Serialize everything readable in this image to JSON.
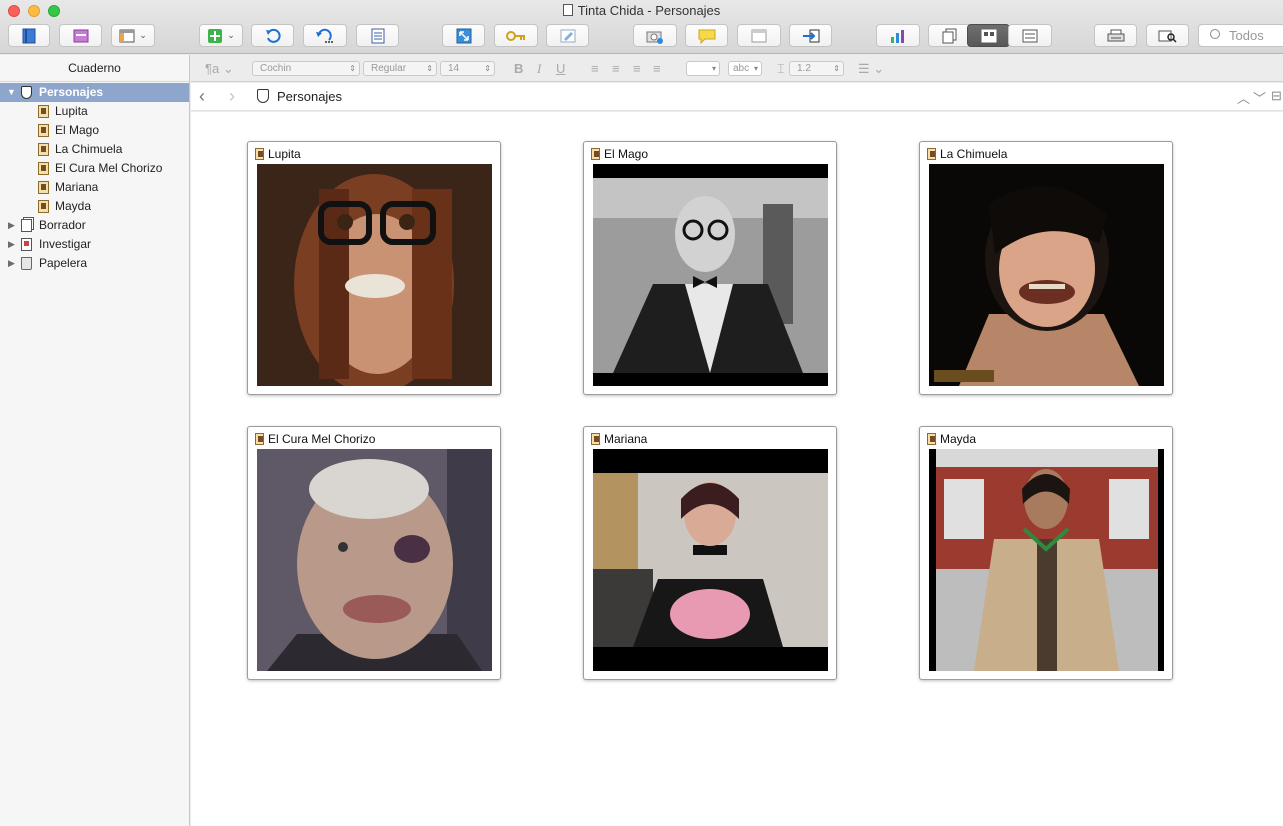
{
  "window": {
    "title": "Tinta Chida - Personajes"
  },
  "toolbar": {
    "search_placeholder": "Todos"
  },
  "sidebar": {
    "header": "Cuaderno",
    "items": [
      {
        "label": "Personajes",
        "icon": "mask-icon",
        "expanded": true,
        "selected": true
      },
      {
        "label": "Lupita",
        "icon": "index-card-icon"
      },
      {
        "label": "El Mago",
        "icon": "index-card-icon"
      },
      {
        "label": "La Chimuela",
        "icon": "index-card-icon"
      },
      {
        "label": "El Cura Mel Chorizo",
        "icon": "index-card-icon"
      },
      {
        "label": "Mariana",
        "icon": "index-card-icon"
      },
      {
        "label": "Mayda",
        "icon": "index-card-icon"
      },
      {
        "label": "Borrador",
        "icon": "draft-icon",
        "expanded": false
      },
      {
        "label": "Investigar",
        "icon": "research-icon",
        "expanded": false
      },
      {
        "label": "Papelera",
        "icon": "trash-icon",
        "expanded": false
      }
    ]
  },
  "formatbar": {
    "font": "Cochin",
    "weight": "Regular",
    "size": "14",
    "line_spacing": "1.2",
    "highlight_label": "abc"
  },
  "navbar": {
    "title": "Personajes"
  },
  "corkboard": {
    "cards": [
      {
        "title": "Lupita",
        "photo_bg": "#5a3a2a"
      },
      {
        "title": "El Mago",
        "photo_bg": "#8a8a8a"
      },
      {
        "title": "La Chimuela",
        "photo_bg": "#1a1410"
      },
      {
        "title": "El Cura Mel Chorizo",
        "photo_bg": "#6b6670"
      },
      {
        "title": "Mariana",
        "photo_bg": "#c9c4bd"
      },
      {
        "title": "Mayda",
        "photo_bg": "#8f3a2e"
      }
    ]
  },
  "colors": {
    "selection": "#8ea6cc",
    "close": "#fc605b",
    "minimize": "#fdbc40",
    "maximize": "#34c84a"
  }
}
